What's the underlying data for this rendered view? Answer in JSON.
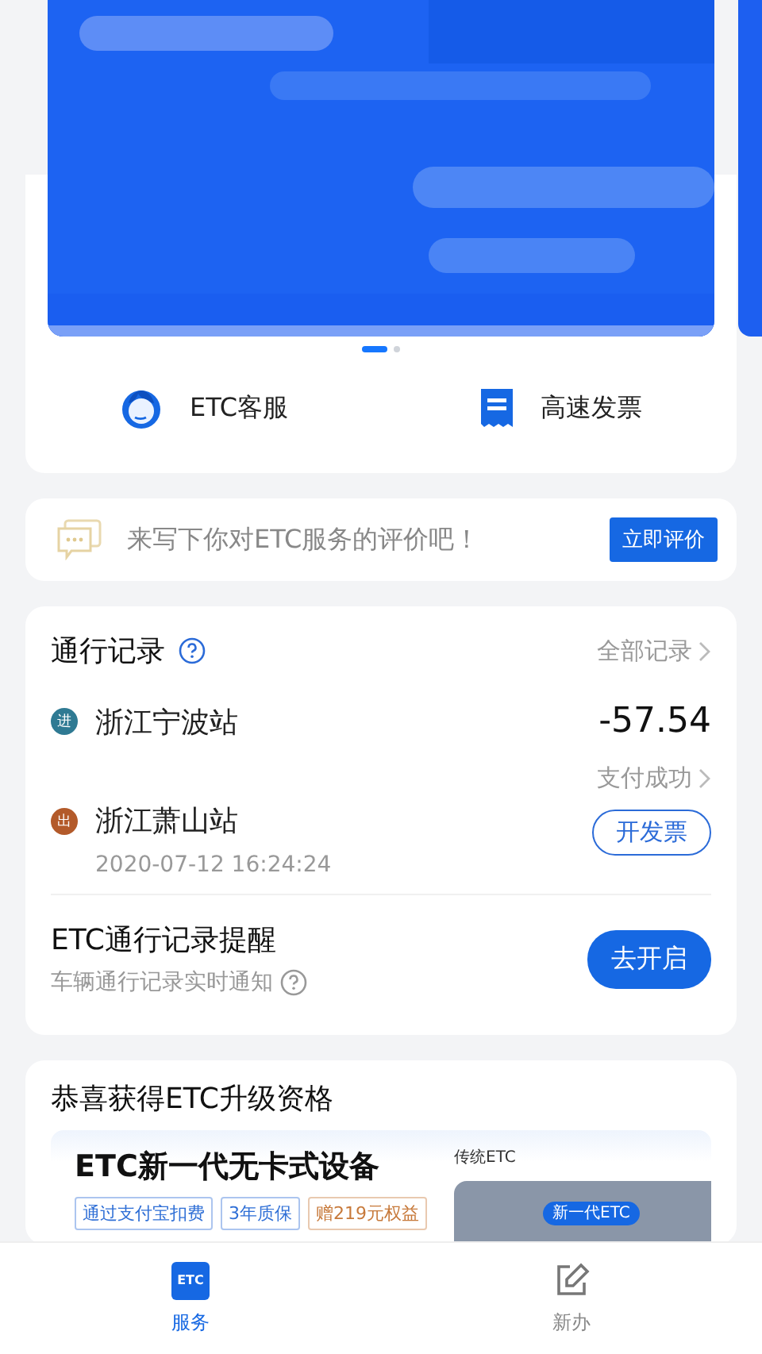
{
  "banner": {
    "pages": [
      {
        "selected": true
      },
      {
        "selected": false
      }
    ]
  },
  "quick_actions": [
    {
      "label": "ETC客服",
      "kind": "agent"
    },
    {
      "label": "高速发票",
      "kind": "invoice"
    }
  ],
  "review_prompt": {
    "text": "来写下你对ETC服务的评价吧！",
    "button": "立即评价"
  },
  "toll_records": {
    "title": "通行记录",
    "all_link": "全部记录",
    "entries": [
      {
        "badge": "进",
        "station": "浙江宁波站",
        "color": "#2f7a93"
      },
      {
        "badge": "出",
        "station": "浙江萧山站",
        "color": "#b35a2a"
      }
    ],
    "amount": "-57.54",
    "time": "2020-07-12 16:24:24",
    "status": "支付成功",
    "invoice_button": "开发票"
  },
  "reminder": {
    "title": "ETC通行记录提醒",
    "subtitle": "车辆通行记录实时通知",
    "button": "去开启"
  },
  "upgrade": {
    "title": "恭喜获得ETC升级资格",
    "product": "ETC新一代无卡式设备",
    "tags": [
      {
        "label": "通过支付宝扣费",
        "color": "#2f6fd6"
      },
      {
        "label": "3年质保",
        "color": "#2f6fd6"
      },
      {
        "label": "赠219元权益",
        "color": "#c7793a"
      }
    ],
    "compare_label": "传统ETC",
    "device_badge": "新一代ETC"
  },
  "tab_bar": [
    {
      "label": "服务",
      "icon_text": "ETC",
      "kind": "etc",
      "selected": true
    },
    {
      "label": "新办",
      "kind": "edit",
      "selected": false
    }
  ]
}
